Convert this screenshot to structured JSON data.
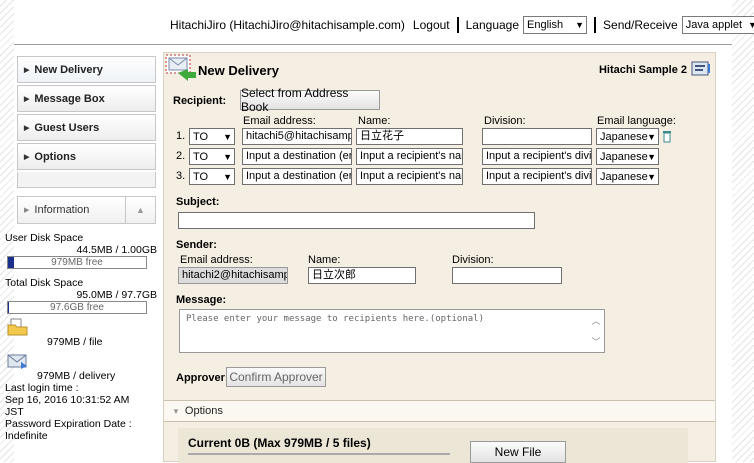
{
  "header": {
    "user": "HitachiJiro (HitachiJiro@hitachisample.com)",
    "logout": "Logout",
    "language_label": "Language",
    "language_value": "English",
    "send_receive_label": "Send/Receive",
    "send_receive_value": "Java applet"
  },
  "sidebar": {
    "items": [
      {
        "label": "New Delivery"
      },
      {
        "label": "Message Box"
      },
      {
        "label": "Guest Users"
      },
      {
        "label": "Options"
      }
    ],
    "information_label": "Information"
  },
  "info": {
    "user_disk_label": "User Disk Space",
    "user_disk_value": "44.5MB / 1.00GB",
    "user_disk_free": "979MB free",
    "user_disk_used_fraction": 0.044,
    "total_disk_label": "Total Disk Space",
    "total_disk_value": "95.0MB / 97.7GB",
    "total_disk_free": "97.6GB free",
    "total_disk_used_fraction": 0.001,
    "per_file": "979MB / file",
    "per_delivery": "979MB / delivery",
    "last_login_label": "Last login time :",
    "last_login_value": "Sep 16, 2016 10:31:52 AM JST",
    "pw_exp_label": "Password Expiration Date :",
    "pw_exp_value": "Indefinite"
  },
  "form": {
    "title": "New Delivery",
    "sample": "Hitachi Sample 2",
    "recipient_label": "Recipient:",
    "address_book_button": "Select from Address Book",
    "col_email": "Email address:",
    "col_name": "Name:",
    "col_division": "Division:",
    "col_language": "Email language:",
    "rows": [
      {
        "num": "1.",
        "type": "TO",
        "email": "hitachi5@hitachisamp",
        "name": "日立花子",
        "division": "",
        "language": "Japanese"
      },
      {
        "num": "2.",
        "type": "TO",
        "email": "Input a destination (er",
        "name": "Input a recipient's nan",
        "division": "Input a recipient's divi:",
        "language": "Japanese"
      },
      {
        "num": "3.",
        "type": "TO",
        "email": "Input a destination (er",
        "name": "Input a recipient's nan",
        "division": "Input a recipient's divi:",
        "language": "Japanese"
      }
    ],
    "subject_label": "Subject:",
    "subject_value": "",
    "sender_label": "Sender:",
    "sender_email_label": "Email address:",
    "sender_name_label": "Name:",
    "sender_division_label": "Division:",
    "sender_email": "hitachi2@hitachisamp",
    "sender_name": "日立次郎",
    "sender_division": "",
    "message_label": "Message:",
    "message_placeholder": "Please enter your message to recipients here.(optional)",
    "approver_label": "Approver:",
    "confirm_approver_button": "Confirm Approver",
    "options_label": "Options",
    "current_upload": "Current 0B (Max  979MB / 5 files)",
    "new_file_button": "New File"
  }
}
